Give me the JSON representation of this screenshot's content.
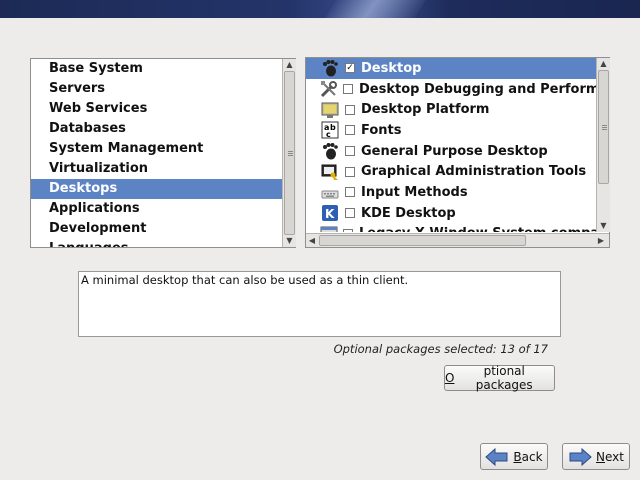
{
  "categories": [
    {
      "label": "Base System"
    },
    {
      "label": "Servers"
    },
    {
      "label": "Web Services"
    },
    {
      "label": "Databases"
    },
    {
      "label": "System Management"
    },
    {
      "label": "Virtualization"
    },
    {
      "label": "Desktops",
      "selected": true
    },
    {
      "label": "Applications"
    },
    {
      "label": "Development"
    },
    {
      "label": "Languages"
    }
  ],
  "groups": [
    {
      "label": "Desktop",
      "icon": "gnome-foot-icon",
      "checked": true,
      "selected": true
    },
    {
      "label": "Desktop Debugging and Performance Tools",
      "icon": "debug-tools-icon",
      "checked": false
    },
    {
      "label": "Desktop Platform",
      "icon": "desktop-platform-icon",
      "checked": false
    },
    {
      "label": "Fonts",
      "icon": "fonts-icon",
      "checked": false
    },
    {
      "label": "General Purpose Desktop",
      "icon": "gnome-foot-icon",
      "checked": false
    },
    {
      "label": "Graphical Administration Tools",
      "icon": "admin-tools-icon",
      "checked": false
    },
    {
      "label": "Input Methods",
      "icon": "keyboard-icon",
      "checked": false
    },
    {
      "label": "KDE Desktop",
      "icon": "kde-icon",
      "checked": false
    },
    {
      "label": "Legacy X Window System compatibility",
      "icon": "x-window-icon",
      "checked": false
    }
  ],
  "description": "A minimal desktop that can also be used as a thin client.",
  "optional_count_text": "Optional packages selected: 13 of 17",
  "buttons": {
    "optional_packages": {
      "underlined": "O",
      "rest": "ptional packages"
    },
    "back": {
      "underlined": "B",
      "rest": "ack"
    },
    "next": {
      "underlined": "N",
      "rest": "ext"
    }
  },
  "colors": {
    "selection": "#5c84c5",
    "banner": "#1c2a55"
  }
}
